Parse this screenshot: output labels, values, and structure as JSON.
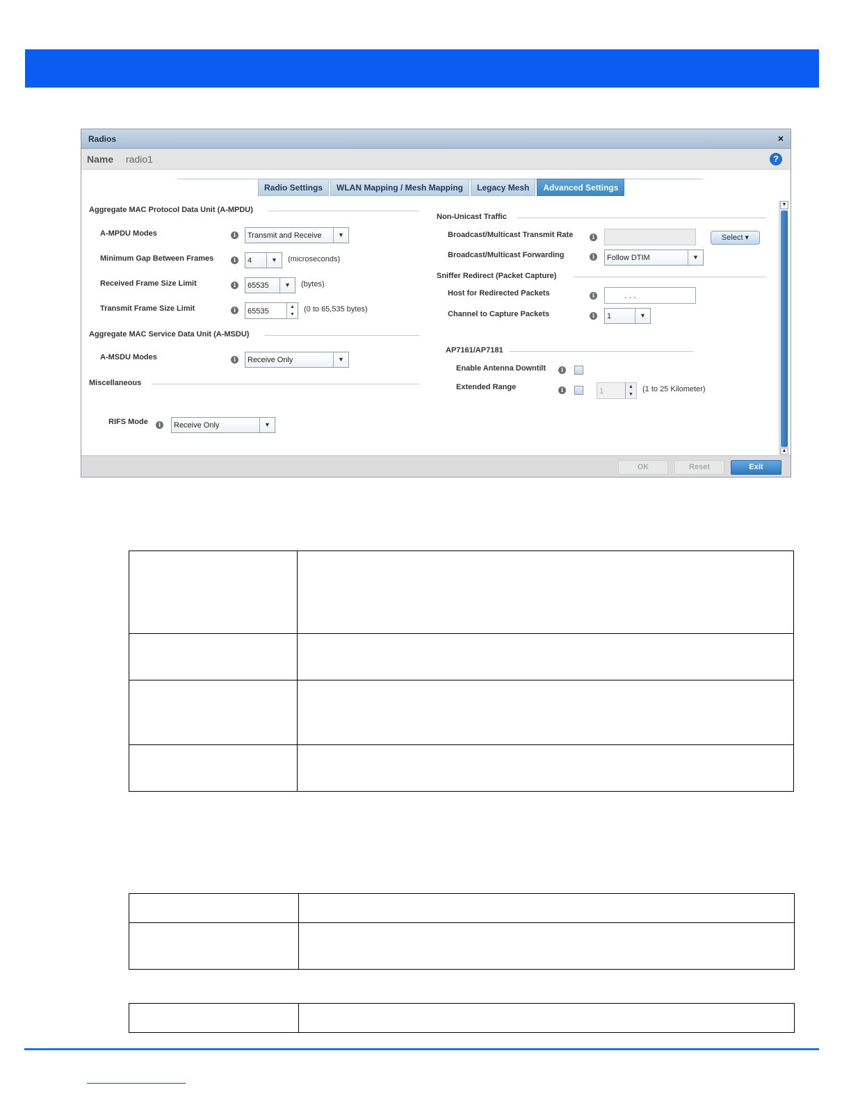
{
  "dialog": {
    "title": "Radios",
    "close": "×",
    "name_label": "Name",
    "name_value": "radio1",
    "help": "?"
  },
  "tabs": [
    "Radio Settings",
    "WLAN Mapping / Mesh Mapping",
    "Legacy Mesh",
    "Advanced Settings"
  ],
  "active_tab": "Advanced Settings",
  "left": {
    "ampdu_section": "Aggregate MAC Protocol Data Unit (A-MPDU)",
    "ampdu_modes_label": "A-MPDU Modes",
    "ampdu_modes_value": "Transmit and Receive",
    "min_gap_label": "Minimum Gap Between Frames",
    "min_gap_value": "4",
    "min_gap_unit": "(microseconds)",
    "rx_frame_label": "Received Frame Size Limit",
    "rx_frame_value": "65535",
    "rx_frame_unit": "(bytes)",
    "tx_frame_label": "Transmit Frame Size Limit",
    "tx_frame_value": "65535",
    "tx_frame_unit": "(0 to 65,535 bytes)",
    "amsdu_section": "Aggregate MAC Service Data Unit (A-MSDU)",
    "amsdu_modes_label": "A-MSDU Modes",
    "amsdu_modes_value": "Receive Only",
    "misc_section": "Miscellaneous",
    "rifs_label": "RIFS Mode",
    "rifs_value": "Receive Only"
  },
  "right": {
    "nonunicast_section": "Non-Unicast Traffic",
    "bm_rate_label": "Broadcast/Multicast Transmit Rate",
    "bm_rate_value": "",
    "select_button": "Select ▾",
    "bm_fwd_label": "Broadcast/Multicast Forwarding",
    "bm_fwd_value": "Follow DTIM",
    "sniffer_section": "Sniffer Redirect (Packet Capture)",
    "host_label": "Host for Redirected Packets",
    "host_value": ".   .   .",
    "channel_label": "Channel to Capture Packets",
    "channel_value": "1",
    "ap_section": "AP7161/AP7181",
    "downtilt_label": "Enable Antenna Downtilt",
    "range_label": "Extended Range",
    "range_value": "1",
    "range_unit": "(1 to 25 Kilometer)"
  },
  "footer": {
    "ok": "OK",
    "reset": "Reset",
    "exit": "Exit"
  },
  "icons": {
    "info": "info-icon",
    "dropdown": "chevron-down-icon",
    "help": "help-icon",
    "close": "close-icon"
  },
  "colors": {
    "header_band": "#0b5cf0",
    "active_tab": "#3d86c2",
    "bottom_rule": "#1a73e8"
  }
}
